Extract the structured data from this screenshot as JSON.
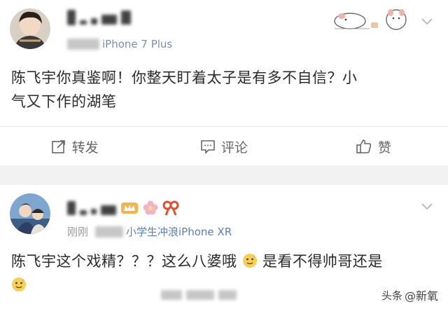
{
  "post1": {
    "device": "iPhone 7 Plus",
    "content_line1": "陈飞宇你真鉴啊！你整天盯着太子是有多不自信？小",
    "content_line2": "气又下作的湖笔",
    "actions": {
      "repost": "转发",
      "comment": "评论",
      "like": "赞"
    }
  },
  "post2": {
    "time": "刚刚",
    "source": "小学生冲浪iPhone XR",
    "content_line1": "陈飞宇这个戏精？？？这么八婆哦",
    "content_line1b": "是看不得帅哥还是",
    "sticker_icon": "sweat-smile-emoji-icon"
  },
  "watermark": {
    "prefix": "头条",
    "handle": "@新氧"
  },
  "colors": {
    "text": "#2b2b2b",
    "muted": "#9a9a9a",
    "separator": "#f2f2f2",
    "link": "#5e7fb0"
  }
}
